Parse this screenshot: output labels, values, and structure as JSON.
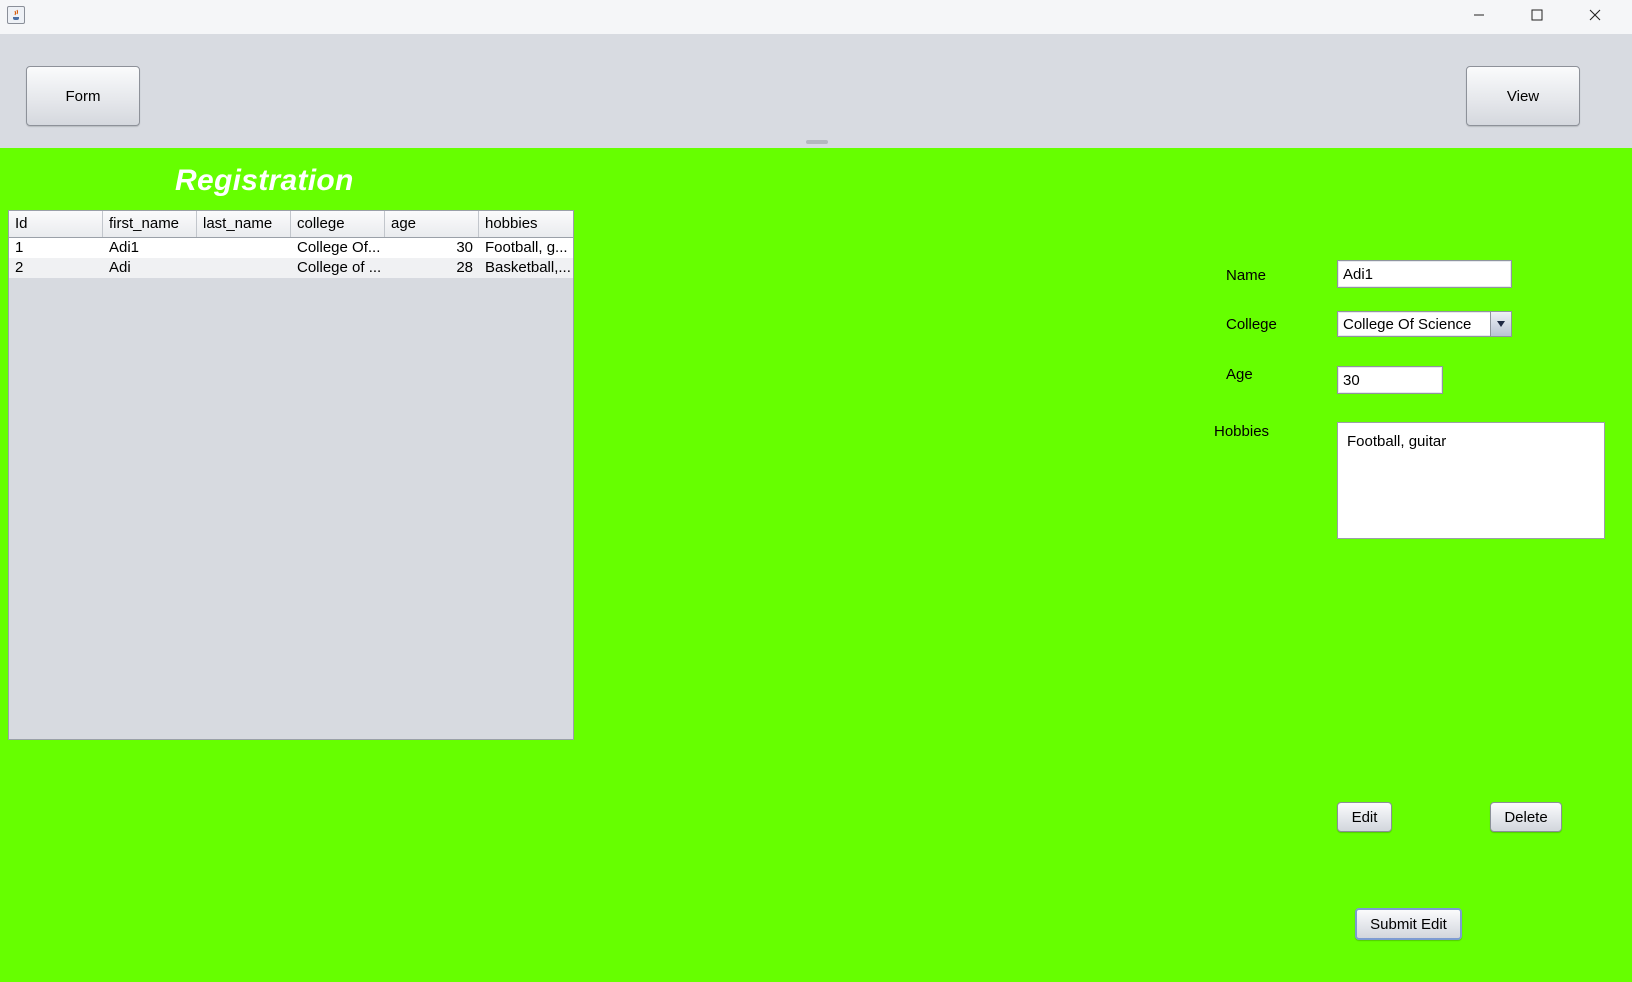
{
  "window": {
    "minimize_icon": "minimize-icon",
    "maximize_icon": "maximize-icon",
    "close_icon": "close-icon"
  },
  "toolbar": {
    "form_label": "Form",
    "view_label": "View"
  },
  "main": {
    "title": "Registration"
  },
  "table": {
    "headers": [
      "Id",
      "first_name",
      "last_name",
      "college",
      "age",
      "hobbies"
    ],
    "rows": [
      {
        "id": "1",
        "first_name": "Adi1",
        "last_name": "",
        "college": "College Of...",
        "age": "30",
        "hobbies": "Football, g..."
      },
      {
        "id": "2",
        "first_name": "Adi",
        "last_name": "",
        "college": "College of ...",
        "age": "28",
        "hobbies": "Basketball,..."
      }
    ]
  },
  "form": {
    "name_label": "Name",
    "name_value": "Adi1",
    "college_label": "College",
    "college_value": "College Of Science",
    "age_label": "Age",
    "age_value": "30",
    "hobbies_label": "Hobbies",
    "hobbies_value": "Football, guitar",
    "edit_label": "Edit",
    "delete_label": "Delete",
    "submit_label": "Submit Edit"
  },
  "colors": {
    "content_background": "#66ff00",
    "toolbar_background": "#d8dbe1",
    "title_text": "#ffffff"
  }
}
